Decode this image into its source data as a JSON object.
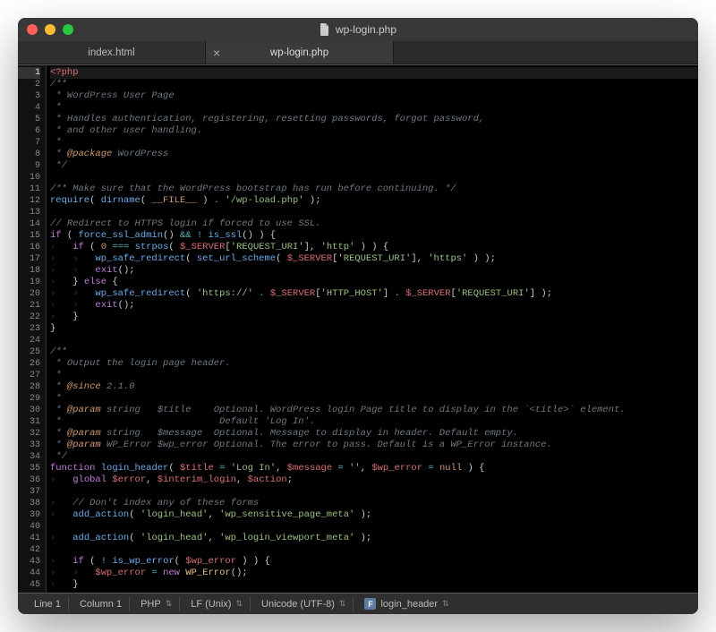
{
  "window": {
    "title": "wp-login.php"
  },
  "tabs": [
    {
      "label": "index.html",
      "active": false
    },
    {
      "label": "wp-login.php",
      "active": true
    }
  ],
  "statusbar": {
    "line": "Line 1",
    "column": "Column 1",
    "language": "PHP",
    "line_endings": "LF (Unix)",
    "encoding": "Unicode (UTF-8)",
    "symbol": "login_header"
  },
  "code": {
    "lines": [
      [
        [
          "c-tag",
          "<?php"
        ]
      ],
      [
        [
          "c-comment",
          "/**"
        ]
      ],
      [
        [
          "c-comment",
          " * WordPress User Page"
        ]
      ],
      [
        [
          "c-comment",
          " *"
        ]
      ],
      [
        [
          "c-comment",
          " * Handles authentication, registering, resetting passwords, forgot password,"
        ]
      ],
      [
        [
          "c-comment",
          " * and other user handling."
        ]
      ],
      [
        [
          "c-comment",
          " *"
        ]
      ],
      [
        [
          "c-comment",
          " * "
        ],
        [
          "c-doctag",
          "@package"
        ],
        [
          "c-comment",
          " WordPress"
        ]
      ],
      [
        [
          "c-comment",
          " */"
        ]
      ],
      [
        [
          "",
          ""
        ]
      ],
      [
        [
          "c-comment",
          "/** Make sure that the WordPress bootstrap has run before continuing. */"
        ]
      ],
      [
        [
          "c-func",
          "require"
        ],
        [
          "c-plain",
          "( "
        ],
        [
          "c-func",
          "dirname"
        ],
        [
          "c-plain",
          "( "
        ],
        [
          "c-const",
          "__FILE__"
        ],
        [
          "c-plain",
          " ) "
        ],
        [
          "c-op",
          "."
        ],
        [
          "c-plain",
          " "
        ],
        [
          "c-str",
          "'/wp-load.php'"
        ],
        [
          "c-plain",
          " );"
        ]
      ],
      [
        [
          "",
          ""
        ]
      ],
      [
        [
          "c-comment",
          "// Redirect to HTTPS login if forced to use SSL."
        ]
      ],
      [
        [
          "c-kw",
          "if"
        ],
        [
          "c-plain",
          " ( "
        ],
        [
          "c-func",
          "force_ssl_admin"
        ],
        [
          "c-plain",
          "() "
        ],
        [
          "c-op",
          "&&"
        ],
        [
          "c-plain",
          " "
        ],
        [
          "c-op",
          "!"
        ],
        [
          "c-plain",
          " "
        ],
        [
          "c-func",
          "is_ssl"
        ],
        [
          "c-plain",
          "() ) {"
        ]
      ],
      [
        [
          "ind",
          "›   "
        ],
        [
          "c-kw",
          "if"
        ],
        [
          "c-plain",
          " ( "
        ],
        [
          "c-num",
          "0"
        ],
        [
          "c-plain",
          " "
        ],
        [
          "c-op",
          "==="
        ],
        [
          "c-plain",
          " "
        ],
        [
          "c-func",
          "strpos"
        ],
        [
          "c-plain",
          "( "
        ],
        [
          "c-var",
          "$_SERVER"
        ],
        [
          "c-plain",
          "["
        ],
        [
          "c-str",
          "'REQUEST_URI'"
        ],
        [
          "c-plain",
          "], "
        ],
        [
          "c-str",
          "'http'"
        ],
        [
          "c-plain",
          " ) ) {"
        ]
      ],
      [
        [
          "ind",
          "›   ›   "
        ],
        [
          "c-func",
          "wp_safe_redirect"
        ],
        [
          "c-plain",
          "( "
        ],
        [
          "c-func",
          "set_url_scheme"
        ],
        [
          "c-plain",
          "( "
        ],
        [
          "c-var",
          "$_SERVER"
        ],
        [
          "c-plain",
          "["
        ],
        [
          "c-str",
          "'REQUEST_URI'"
        ],
        [
          "c-plain",
          "], "
        ],
        [
          "c-str",
          "'https'"
        ],
        [
          "c-plain",
          " ) );"
        ]
      ],
      [
        [
          "ind",
          "›   ›   "
        ],
        [
          "c-kw",
          "exit"
        ],
        [
          "c-plain",
          "();"
        ]
      ],
      [
        [
          "ind",
          "›   "
        ],
        [
          "c-plain",
          "} "
        ],
        [
          "c-kw",
          "else"
        ],
        [
          "c-plain",
          " {"
        ]
      ],
      [
        [
          "ind",
          "›   ›   "
        ],
        [
          "c-func",
          "wp_safe_redirect"
        ],
        [
          "c-plain",
          "( "
        ],
        [
          "c-str",
          "'https://'"
        ],
        [
          "c-plain",
          " "
        ],
        [
          "c-op",
          "."
        ],
        [
          "c-plain",
          " "
        ],
        [
          "c-var",
          "$_SERVER"
        ],
        [
          "c-plain",
          "["
        ],
        [
          "c-str",
          "'HTTP_HOST'"
        ],
        [
          "c-plain",
          "] "
        ],
        [
          "c-op",
          "."
        ],
        [
          "c-plain",
          " "
        ],
        [
          "c-var",
          "$_SERVER"
        ],
        [
          "c-plain",
          "["
        ],
        [
          "c-str",
          "'REQUEST_URI'"
        ],
        [
          "c-plain",
          "] );"
        ]
      ],
      [
        [
          "ind",
          "›   ›   "
        ],
        [
          "c-kw",
          "exit"
        ],
        [
          "c-plain",
          "();"
        ]
      ],
      [
        [
          "ind",
          "›   "
        ],
        [
          "c-plain",
          "}"
        ]
      ],
      [
        [
          "c-plain",
          "}"
        ]
      ],
      [
        [
          "",
          ""
        ]
      ],
      [
        [
          "c-comment",
          "/**"
        ]
      ],
      [
        [
          "c-comment",
          " * Output the login page header."
        ]
      ],
      [
        [
          "c-comment",
          " *"
        ]
      ],
      [
        [
          "c-comment",
          " * "
        ],
        [
          "c-doctag",
          "@since"
        ],
        [
          "c-comment",
          " 2.1.0"
        ]
      ],
      [
        [
          "c-comment",
          " *"
        ]
      ],
      [
        [
          "c-comment",
          " * "
        ],
        [
          "c-doctag",
          "@param"
        ],
        [
          "c-comment",
          " string   $title    Optional. WordPress login Page title to display in the `<title>` element."
        ]
      ],
      [
        [
          "c-comment",
          " *                            Default 'Log In'."
        ]
      ],
      [
        [
          "c-comment",
          " * "
        ],
        [
          "c-doctag",
          "@param"
        ],
        [
          "c-comment",
          " string   $message  Optional. Message to display in header. Default empty."
        ]
      ],
      [
        [
          "c-comment",
          " * "
        ],
        [
          "c-doctag",
          "@param"
        ],
        [
          "c-comment",
          " WP_Error $wp_error Optional. The error to pass. Default is a WP_Error instance."
        ]
      ],
      [
        [
          "c-comment",
          " */"
        ]
      ],
      [
        [
          "c-kw",
          "function"
        ],
        [
          "c-plain",
          " "
        ],
        [
          "c-func",
          "login_header"
        ],
        [
          "c-plain",
          "( "
        ],
        [
          "c-var",
          "$title"
        ],
        [
          "c-plain",
          " "
        ],
        [
          "c-op",
          "="
        ],
        [
          "c-plain",
          " "
        ],
        [
          "c-str",
          "'Log In'"
        ],
        [
          "c-plain",
          ", "
        ],
        [
          "c-var",
          "$message"
        ],
        [
          "c-plain",
          " "
        ],
        [
          "c-op",
          "="
        ],
        [
          "c-plain",
          " "
        ],
        [
          "c-str",
          "''"
        ],
        [
          "c-plain",
          ", "
        ],
        [
          "c-var",
          "$wp_error"
        ],
        [
          "c-plain",
          " "
        ],
        [
          "c-op",
          "="
        ],
        [
          "c-plain",
          " "
        ],
        [
          "c-const",
          "null"
        ],
        [
          "c-plain",
          " ) {"
        ]
      ],
      [
        [
          "ind",
          "›   "
        ],
        [
          "c-kw",
          "global"
        ],
        [
          "c-plain",
          " "
        ],
        [
          "c-var",
          "$error"
        ],
        [
          "c-plain",
          ", "
        ],
        [
          "c-var",
          "$interim_login"
        ],
        [
          "c-plain",
          ", "
        ],
        [
          "c-var",
          "$action"
        ],
        [
          "c-plain",
          ";"
        ]
      ],
      [
        [
          "",
          ""
        ]
      ],
      [
        [
          "ind",
          "›   "
        ],
        [
          "c-comment",
          "// Don't index any of these forms"
        ]
      ],
      [
        [
          "ind",
          "›   "
        ],
        [
          "c-func",
          "add_action"
        ],
        [
          "c-plain",
          "( "
        ],
        [
          "c-str",
          "'login_head'"
        ],
        [
          "c-plain",
          ", "
        ],
        [
          "c-str",
          "'wp_sensitive_page_meta'"
        ],
        [
          "c-plain",
          " );"
        ]
      ],
      [
        [
          "",
          ""
        ]
      ],
      [
        [
          "ind",
          "›   "
        ],
        [
          "c-func",
          "add_action"
        ],
        [
          "c-plain",
          "( "
        ],
        [
          "c-str",
          "'login_head'"
        ],
        [
          "c-plain",
          ", "
        ],
        [
          "c-str",
          "'wp_login_viewport_meta'"
        ],
        [
          "c-plain",
          " );"
        ]
      ],
      [
        [
          "",
          ""
        ]
      ],
      [
        [
          "ind",
          "›   "
        ],
        [
          "c-kw",
          "if"
        ],
        [
          "c-plain",
          " ( "
        ],
        [
          "c-op",
          "!"
        ],
        [
          "c-plain",
          " "
        ],
        [
          "c-func",
          "is_wp_error"
        ],
        [
          "c-plain",
          "( "
        ],
        [
          "c-var",
          "$wp_error"
        ],
        [
          "c-plain",
          " ) ) {"
        ]
      ],
      [
        [
          "ind",
          "›   ›   "
        ],
        [
          "c-var",
          "$wp_error"
        ],
        [
          "c-plain",
          " "
        ],
        [
          "c-op",
          "="
        ],
        [
          "c-plain",
          " "
        ],
        [
          "c-kw",
          "new"
        ],
        [
          "c-plain",
          " "
        ],
        [
          "c-type",
          "WP_Error"
        ],
        [
          "c-plain",
          "();"
        ]
      ],
      [
        [
          "ind",
          "›   "
        ],
        [
          "c-plain",
          "}"
        ]
      ]
    ]
  }
}
